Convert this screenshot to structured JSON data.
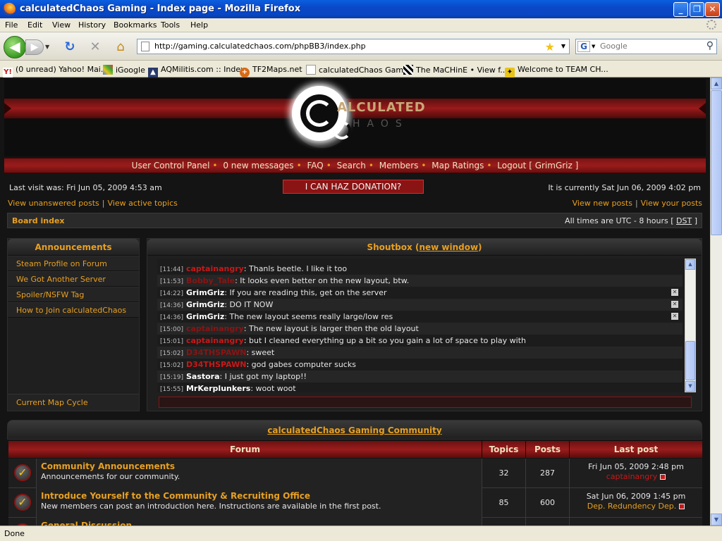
{
  "browser": {
    "title": "calculatedChaos Gaming - Index page - Mozilla Firefox",
    "menu": [
      "File",
      "Edit",
      "View",
      "History",
      "Bookmarks",
      "Tools",
      "Help"
    ],
    "url": "http://gaming.calculatedchaos.com/phpBB3/index.php",
    "search_placeholder": "Google",
    "bookmarks": [
      {
        "label": "(0 unread) Yahoo! Mai...",
        "icon": "yahoo-icon"
      },
      {
        "label": "iGoogle",
        "icon": "google-icon"
      },
      {
        "label": "AQMilitis.com :: Index",
        "icon": "aqm-icon"
      },
      {
        "label": "TF2Maps.net",
        "icon": "tf2-icon"
      },
      {
        "label": "calculatedChaos Gami...",
        "icon": "page-icon"
      },
      {
        "label": "The MaCHinE • View f...",
        "icon": "machine-icon"
      },
      {
        "label": "Welcome to TEAM CH...",
        "icon": "team-icon"
      }
    ],
    "status": "Done"
  },
  "site": {
    "logo_text_top": "ALCULATED",
    "logo_text_bottom": "HAOS",
    "nav": [
      "User Control Panel",
      "0 new messages",
      "FAQ",
      "Search",
      "Members",
      "Map Ratings",
      "Logout [ GrimGriz ]"
    ],
    "last_visit": "Last visit was: Fri Jun 05, 2009 4:53 am",
    "donate": "I CAN HAZ DONATION?",
    "current_time": "It is currently Sat Jun 06, 2009 4:02 pm",
    "left_links": [
      "View unanswered posts",
      "View active topics"
    ],
    "right_links": [
      "View new posts",
      "View your posts"
    ],
    "board_index": "Board index",
    "timezone_prefix": "All times are UTC - 8 hours [",
    "timezone_dst": "DST",
    "timezone_suffix": "]"
  },
  "announcements": {
    "title": "Announcements",
    "items": [
      "Steam Profile on Forum",
      "We Got Another Server",
      "Spoiler/NSFW Tag",
      "How to Join calculatedChaos"
    ],
    "footer": "Current Map Cycle"
  },
  "shoutbox": {
    "title": "Shoutbox",
    "link": "new window",
    "entries": [
      {
        "time": "[11:44]",
        "user": "captainangry",
        "color": "#c81818",
        "msg": ": Thanls beetle. I like it too",
        "del": false
      },
      {
        "time": "[11:53]",
        "user": "Bobby_Tale",
        "color": "#8a1414",
        "msg": ": It looks even better on the new layout, btw.",
        "del": false
      },
      {
        "time": "[14:22]",
        "user": "GrimGriz",
        "color": "#ffffff",
        "msg": ": If you are reading this, get on the server",
        "del": true
      },
      {
        "time": "[14:36]",
        "user": "GrimGriz",
        "color": "#ffffff",
        "msg": ": DO IT NOW",
        "del": true
      },
      {
        "time": "[14:36]",
        "user": "GrimGriz",
        "color": "#ffffff",
        "msg": ": The new layout seems really large/low res",
        "del": true
      },
      {
        "time": "[15:00]",
        "user": "captainangry",
        "color": "#8a1414",
        "msg": ": The new layout is larger then the old layout",
        "del": false
      },
      {
        "time": "[15:01]",
        "user": "captainangry",
        "color": "#c81818",
        "msg": ": but I cleaned everything up a bit so you gain a lot of space to play with",
        "del": false
      },
      {
        "time": "[15:02]",
        "user": "D34THSPAWN",
        "color": "#8a1414",
        "msg": ": sweet",
        "del": false
      },
      {
        "time": "[15:02]",
        "user": "D34THSPAWN",
        "color": "#c81818",
        "msg": ": god gabes computer sucks",
        "del": false
      },
      {
        "time": "[15:19]",
        "user": "Sastora",
        "color": "#ffffff",
        "msg": ": I just got my laptop!!",
        "del": false
      },
      {
        "time": "[15:55]",
        "user": "MrKerplunkers",
        "color": "#ffffff",
        "msg": ": woot woot",
        "del": false
      }
    ]
  },
  "forum": {
    "section_title": "calculatedChaos Gaming Community",
    "headers": {
      "forum": "Forum",
      "topics": "Topics",
      "posts": "Posts",
      "last_post": "Last post"
    },
    "rows": [
      {
        "name": "Community Announcements",
        "desc": "Announcements for our community.",
        "topics": "32",
        "posts": "287",
        "last_date": "Fri Jun 05, 2009 2:48 pm",
        "last_by": "captainangry",
        "last_by_color": "red"
      },
      {
        "name": "Introduce Yourself to the Community & Recruiting Office",
        "desc": "New members can post an introduction here. Instructions are available in the first post.",
        "topics": "85",
        "posts": "600",
        "last_date": "Sat Jun 06, 2009 1:45 pm",
        "last_by": "Dep. Redundency Dep.",
        "last_by_color": "gold"
      },
      {
        "name": "General Discussion",
        "desc": "",
        "topics": "",
        "posts": "",
        "last_date": "",
        "last_by": "",
        "last_by_color": "red"
      }
    ]
  },
  "colors": {
    "accent": "#e8a020",
    "brand_red": "#9a1c1c",
    "bg": "#141414"
  }
}
